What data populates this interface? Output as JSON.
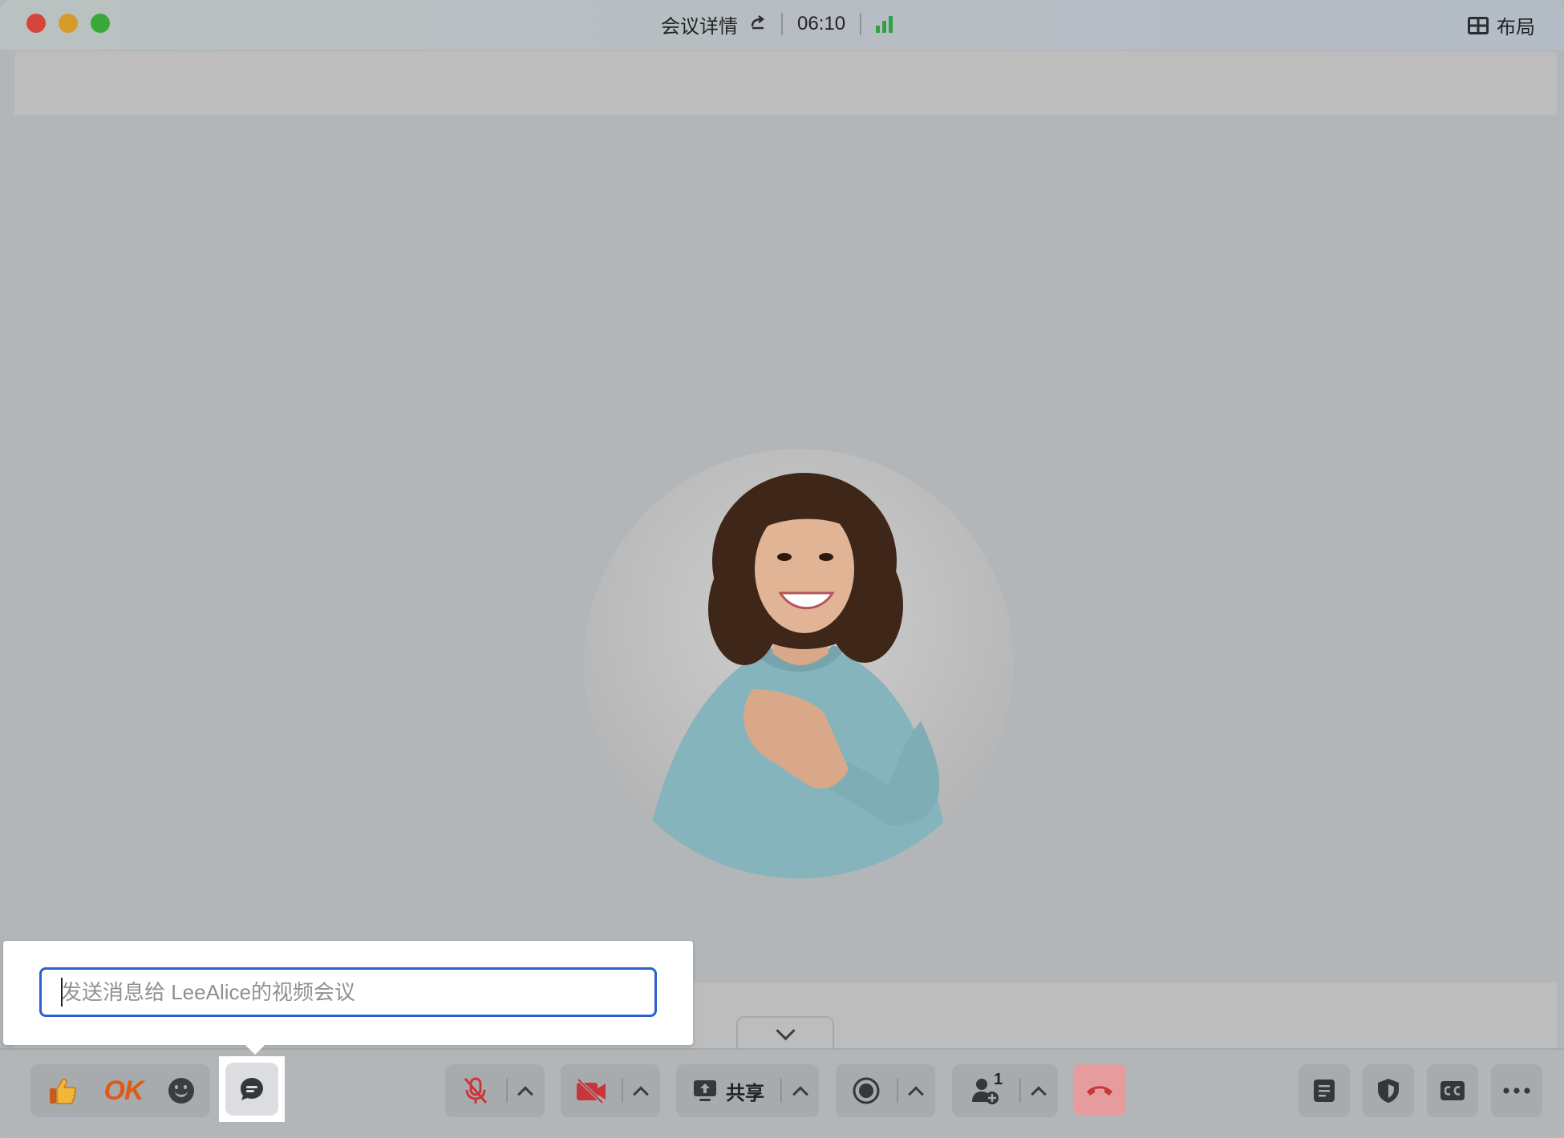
{
  "titlebar": {
    "meeting_details": "会议详情",
    "timer": "06:10",
    "layout_label": "布局"
  },
  "message": {
    "placeholder": "发送消息给 LeeAlice的视频会议"
  },
  "toolbar": {
    "ok_label": "OK",
    "share_label": "共享",
    "participants_count": "1"
  },
  "colors": {
    "signal": "#2fa043",
    "hangup": "#e69c9c",
    "input_border": "#2d5fd1",
    "mute_red": "#c9363a"
  }
}
